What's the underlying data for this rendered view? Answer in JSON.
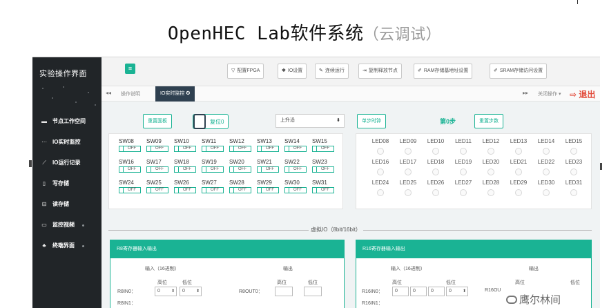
{
  "page_title": {
    "main": "OpenHEC Lab软件系统",
    "sub": "（云调试）"
  },
  "sidebar": {
    "title": "实验操作界面",
    "items": [
      {
        "icon": "folder-icon",
        "glyph": "▬",
        "label": "节点工作空间"
      },
      {
        "icon": "monitor-icon",
        "glyph": "⋯",
        "label": "IO实时监控"
      },
      {
        "icon": "chart-icon",
        "glyph": "⟋",
        "label": "IO运行记录"
      },
      {
        "icon": "file-icon",
        "glyph": "▯",
        "label": "写存储"
      },
      {
        "icon": "database-icon",
        "glyph": "⊟",
        "label": "读存储"
      },
      {
        "icon": "display-icon",
        "glyph": "▭",
        "label": "监控视频"
      },
      {
        "icon": "terminal-icon",
        "glyph": "♣",
        "label": "终端界面"
      }
    ]
  },
  "toolbar": {
    "menu_icon": "≡",
    "buttons": [
      {
        "icon": "filter-icon",
        "glyph": "▽",
        "label": "配置FPGA"
      },
      {
        "icon": "gear-icon",
        "glyph": "✱",
        "label": "IO设置"
      },
      {
        "icon": "pencil-icon",
        "glyph": "✎",
        "label": "连续运行"
      },
      {
        "icon": "signout-icon",
        "glyph": "⇥",
        "label": "复制释放节点"
      },
      {
        "icon": "wrench-icon",
        "glyph": "✐",
        "label": "RAM存储基地址设置"
      },
      {
        "icon": "wrench-icon",
        "glyph": "✐",
        "label": "SRAM存储访问设置"
      }
    ]
  },
  "tabs": {
    "prev": "◂◂",
    "items": [
      {
        "label": "操作说明"
      },
      {
        "label": "IO实时监控 ✪"
      }
    ],
    "next": "▸▸",
    "close_ops": "关闭操作 ▾",
    "exit": "⇨ 退出"
  },
  "controls": {
    "reset_screen": "重置面板",
    "reset_check": "复位0",
    "edge_select": {
      "value": "上升沿",
      "arrow": "⬍"
    },
    "step_clock": "单步时钟",
    "step_status": "第0步",
    "reset_steps": "重置步数"
  },
  "switches": [
    [
      "SW08",
      "SW09",
      "SW10",
      "SW11",
      "SW12",
      "SW13",
      "SW14",
      "SW15"
    ],
    [
      "SW16",
      "SW17",
      "SW18",
      "SW19",
      "SW20",
      "SW21",
      "SW22",
      "SW23"
    ],
    [
      "SW24",
      "SW25",
      "SW26",
      "SW27",
      "SW28",
      "SW29",
      "SW30",
      "SW31"
    ]
  ],
  "switch_state": "OFF",
  "leds": [
    [
      "LED08",
      "LED09",
      "LED10",
      "LED11",
      "LED12",
      "LED13",
      "LED14",
      "LED15"
    ],
    [
      "LED16",
      "LED17",
      "LED18",
      "LED19",
      "LED20",
      "LED21",
      "LED22",
      "LED23"
    ],
    [
      "LED24",
      "LED25",
      "LED26",
      "LED27",
      "LED28",
      "LED29",
      "LED30",
      "LED31"
    ]
  ],
  "virtual_io_label": "虚拟IO（8bit/16bit）",
  "reg8": {
    "title": "R8寄存器输入输出",
    "input_head": "输入（16进制）",
    "output_head": "输出",
    "high": "高位",
    "low": "低位",
    "out_high": "高位",
    "out_low": "低位",
    "row_in_label": "R8IN0：",
    "row_out_label": "R8OUT0：",
    "row2_label": "R8IN1：",
    "val_high": "0",
    "val_low": "0"
  },
  "reg16": {
    "title": "R16寄存器输入输出",
    "input_head": "输入（16进制）",
    "output_head": "输出",
    "high": "高位",
    "low": "低位",
    "out_high": "高位",
    "out_low": "低位",
    "row_in_label": "R16IN0：",
    "row_out_label": "R16OU",
    "row2_label": "R16IN1：",
    "vals": [
      "0",
      "0",
      "0",
      "0"
    ]
  },
  "watermark": "鹰尔林间"
}
